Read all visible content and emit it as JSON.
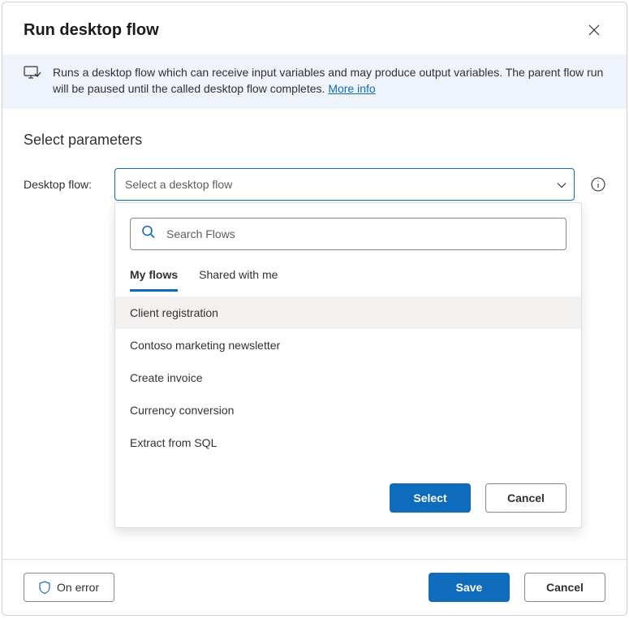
{
  "dialog": {
    "title": "Run desktop flow"
  },
  "banner": {
    "text": "Runs a desktop flow which can receive input variables and may produce output variables. The parent flow run will be paused until the called desktop flow completes. ",
    "link_text": "More info"
  },
  "section": {
    "title": "Select parameters"
  },
  "field": {
    "label": "Desktop flow:",
    "placeholder": "Select a desktop flow"
  },
  "dropdown": {
    "search_placeholder": "Search Flows",
    "tabs": [
      {
        "label": "My flows",
        "active": true
      },
      {
        "label": "Shared with me",
        "active": false
      }
    ],
    "flows": [
      {
        "name": "Client registration",
        "highlighted": true
      },
      {
        "name": "Contoso marketing newsletter",
        "highlighted": false
      },
      {
        "name": "Create invoice",
        "highlighted": false
      },
      {
        "name": "Currency conversion",
        "highlighted": false
      },
      {
        "name": "Extract from SQL",
        "highlighted": false
      }
    ],
    "select_label": "Select",
    "cancel_label": "Cancel"
  },
  "footer": {
    "on_error_label": "On error",
    "save_label": "Save",
    "cancel_label": "Cancel"
  }
}
